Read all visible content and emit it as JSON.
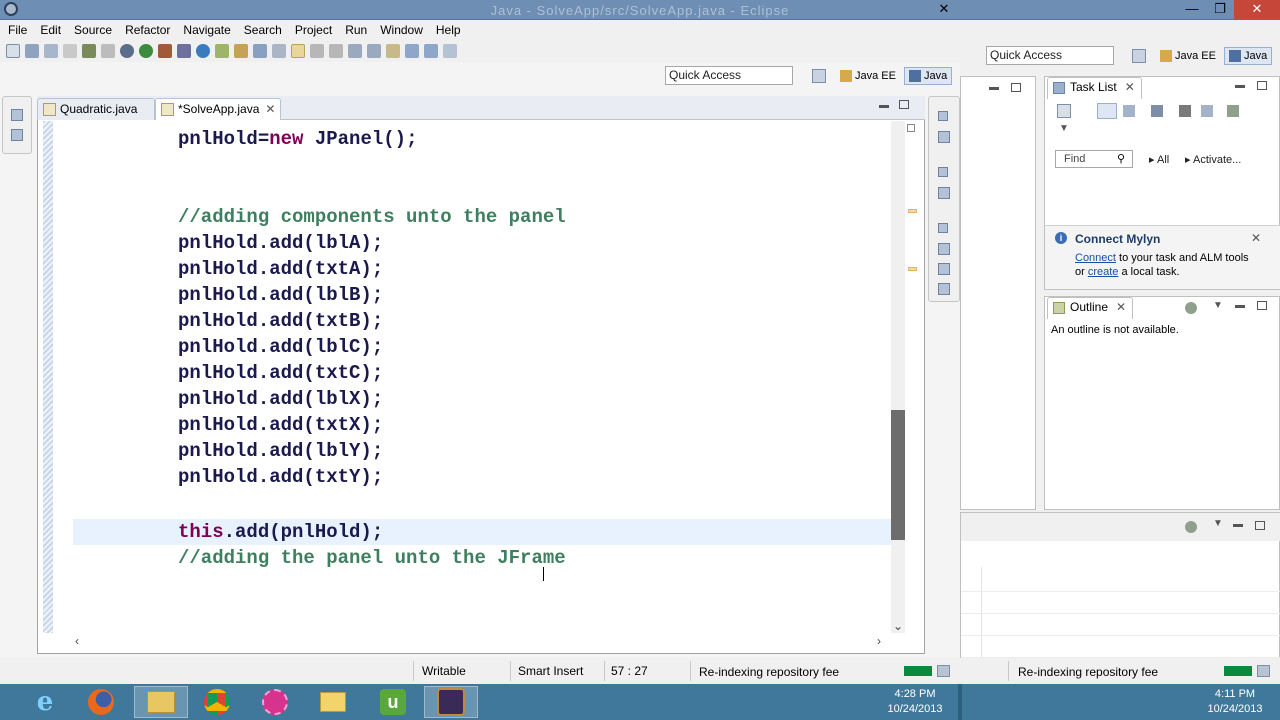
{
  "window": {
    "title": "Java - SolveApp/src/SolveApp.java - Eclipse"
  },
  "menu": [
    "File",
    "Edit",
    "Source",
    "Refactor",
    "Navigate",
    "Search",
    "Project",
    "Run",
    "Window",
    "Help"
  ],
  "toolbar": {
    "quick_access": "Quick Access",
    "persp_java_ee": "Java EE",
    "persp_java": "Java"
  },
  "editor": {
    "tabs": [
      {
        "label": "Quadratic.java"
      },
      {
        "label": "*SolveApp.java"
      }
    ],
    "lines": [
      {
        "pre": "",
        "obj": "pnlHold",
        "text": "=",
        "kw": "new",
        "rest": " JPanel();"
      },
      {
        "pre": "",
        "obj": "",
        "text": "",
        "kw": "",
        "rest": ""
      },
      {
        "pre": "",
        "obj": "",
        "text": "",
        "kw": "",
        "rest": ""
      },
      {
        "comment": "//adding components unto the panel"
      },
      {
        "obj": "pnlHold",
        "rest": ".add(lblA);"
      },
      {
        "obj": "pnlHold",
        "rest": ".add(txtA);"
      },
      {
        "obj": "pnlHold",
        "rest": ".add(lblB);"
      },
      {
        "obj": "pnlHold",
        "rest": ".add(txtB);"
      },
      {
        "obj": "pnlHold",
        "rest": ".add(lblC);"
      },
      {
        "obj": "pnlHold",
        "rest": ".add(txtC);"
      },
      {
        "obj": "pnlHold",
        "rest": ".add(lblX);"
      },
      {
        "obj": "pnlHold",
        "rest": ".add(txtX);"
      },
      {
        "obj": "pnlHold",
        "rest": ".add(lblY);"
      },
      {
        "obj": "pnlHold",
        "rest": ".add(txtY);"
      },
      {
        "comment": ""
      },
      {
        "kw": "this",
        "rest": ".add(pnlHold);"
      },
      {
        "comment": "//adding the panel unto the JFrame"
      }
    ],
    "l0": {
      "obj": "pnlHold",
      "eq": "=",
      "kw": "new",
      "rest": " JPanel();"
    },
    "l3": "//adding components unto the panel",
    "l4": "pnlHold.add(lblA);",
    "l5": "pnlHold.add(txtA);",
    "l6": "pnlHold.add(lblB);",
    "l7": "pnlHold.add(txtB);",
    "l8": "pnlHold.add(lblC);",
    "l9": "pnlHold.add(txtC);",
    "l10": "pnlHold.add(lblX);",
    "l11": "pnlHold.add(txtX);",
    "l12": "pnlHold.add(lblY);",
    "l13": "pnlHold.add(txtY);",
    "l15": {
      "kw": "this",
      "rest": ".add(pnlHold);"
    },
    "l16": "//adding the panel unto the JFrame"
  },
  "status": {
    "writable": "Writable",
    "insert_mode": "Smart Insert",
    "position": "57 : 27",
    "task": "Re-indexing repository fee",
    "task2": "Re-indexing repository fee"
  },
  "right_panel": {
    "quick_access": "Quick Access",
    "persp_java_ee": "Java EE",
    "persp_java": "Java",
    "task_list": {
      "title": "Task List",
      "find_placeholder": "Find",
      "filter_all": "All",
      "filter_activate": "Activate..."
    },
    "mylyn": {
      "title": "Connect Mylyn",
      "connect_link": "Connect",
      "line1_rest": " to your task and ALM tools",
      "or": "or ",
      "create_link": "create",
      "line2_rest": " a local task."
    },
    "outline": {
      "title": "Outline",
      "empty_message": "An outline is not available."
    }
  },
  "taskbar": {
    "clock1_time": "4:28 PM",
    "clock1_date": "10/24/2013",
    "clock2_time": "4:11 PM",
    "clock2_date": "10/24/2013"
  },
  "colors": {
    "keyword": "#7f0055",
    "comment": "#3f7f5f",
    "taskbar": "#40789c",
    "link": "#1a4fa6"
  }
}
